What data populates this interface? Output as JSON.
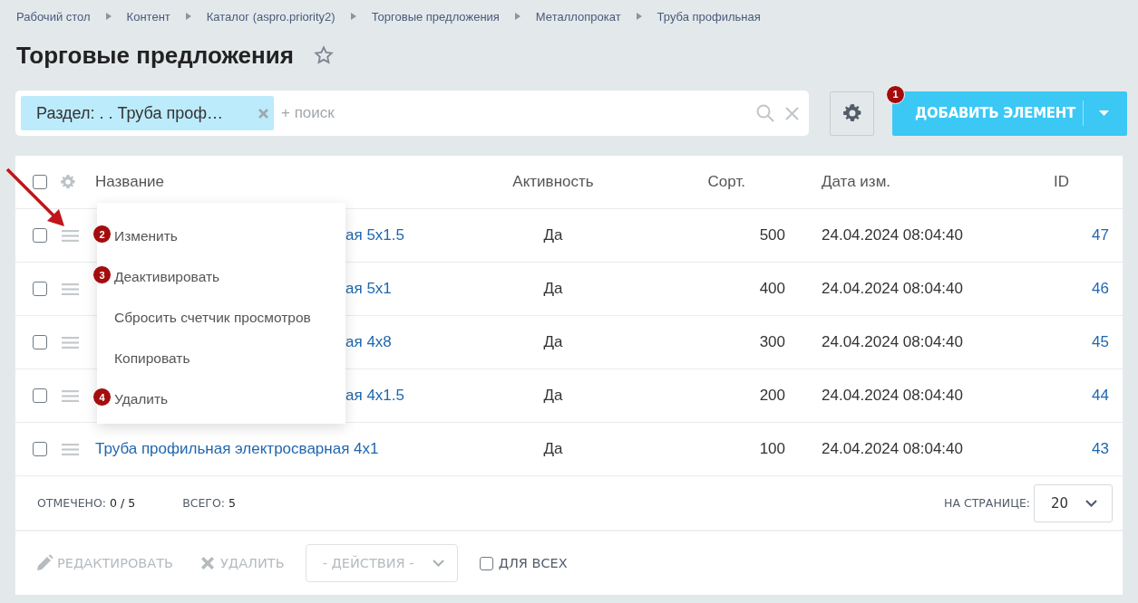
{
  "breadcrumbs": [
    "Рабочий стол",
    "Контент",
    "Каталог (aspro.priority2)",
    "Торговые предложения",
    "Металлопрокат",
    "Труба профильная"
  ],
  "page_title": "Торговые предложения",
  "filter": {
    "tag": "Раздел: . . Труба проф…",
    "placeholder": "+ поиск"
  },
  "add_button": {
    "label": "ДОБАВИТЬ ЭЛЕМЕНТ",
    "badge": "1"
  },
  "table": {
    "all_checked": false,
    "columns": [
      "Название",
      "Активность",
      "Сорт.",
      "Дата изм.",
      "ID"
    ],
    "rows": [
      {
        "checked": false,
        "covered": true,
        "name": "ая 5x1.5",
        "active": "Да",
        "sort": "500",
        "date": "24.04.2024 08:04:40",
        "id": "47"
      },
      {
        "checked": false,
        "covered": true,
        "name": "ая 5x1",
        "active": "Да",
        "sort": "400",
        "date": "24.04.2024 08:04:40",
        "id": "46"
      },
      {
        "checked": false,
        "covered": true,
        "name": "ая 4x8",
        "active": "Да",
        "sort": "300",
        "date": "24.04.2024 08:04:40",
        "id": "45"
      },
      {
        "checked": false,
        "covered": true,
        "name": "ая 4x1.5",
        "active": "Да",
        "sort": "200",
        "date": "24.04.2024 08:04:40",
        "id": "44"
      },
      {
        "checked": false,
        "covered": false,
        "name": "Труба профильная электросварная 4x1",
        "active": "Да",
        "sort": "100",
        "date": "24.04.2024 08:04:40",
        "id": "43"
      }
    ]
  },
  "context_menu": [
    {
      "label": "Изменить",
      "badge": "2"
    },
    {
      "label": "Деактивировать",
      "badge": "3"
    },
    {
      "label": "Сбросить счетчик просмотров"
    },
    {
      "label": "Копировать"
    },
    {
      "label": "Удалить",
      "badge": "4"
    }
  ],
  "footer": {
    "marked_label": "ОТМЕЧЕНО:",
    "marked_value": "0 / 5",
    "total_label": "ВСЕГО:",
    "total_value": "5",
    "per_page_label": "НА СТРАНИЦЕ:",
    "per_page": "20"
  },
  "actions": {
    "edit": {
      "label": "РЕДАКТИРОВАТЬ",
      "disabled": true
    },
    "delete": {
      "label": "УДАЛИТЬ",
      "disabled": true
    },
    "select": "- ДЕЙСТВИЯ -",
    "for_all": {
      "label": "ДЛЯ ВСЕХ",
      "checked": false
    }
  }
}
